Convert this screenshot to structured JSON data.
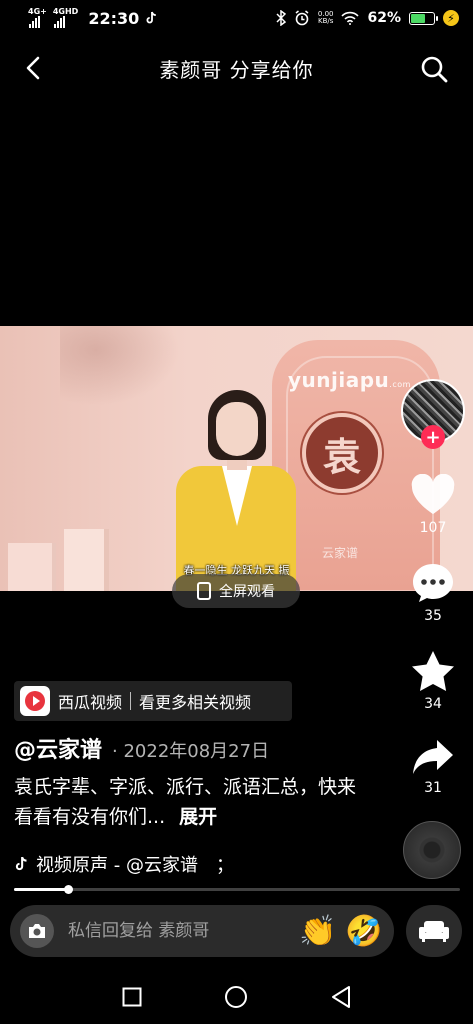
{
  "status_bar": {
    "network_1": "4G+",
    "network_2": "4GHD",
    "time": "22:30",
    "net_speed_value": "0.00",
    "net_speed_unit": "KB/s",
    "battery_percent": "62%",
    "battery_level": 0.62,
    "battery_color": "#4cd964"
  },
  "header": {
    "title": "素颜哥 分享给你",
    "back_icon": "chevron-left-icon",
    "search_icon": "search-icon"
  },
  "video": {
    "watermark_site": "yunjiapu",
    "watermark_tld": ".com",
    "seal_char": "袁",
    "card_brand": "云家谱",
    "subtitle": "春一隐生 龙跃九天 振",
    "fullscreen_label": "全屏观看"
  },
  "side": {
    "like_count": "107",
    "comment_count": "35",
    "favorite_count": "34",
    "share_count": "31",
    "follow_icon": "plus-icon",
    "accent_color": "#fe2c55"
  },
  "info": {
    "xigua_name": "西瓜视频",
    "xigua_more": "看更多相关视频",
    "author": "@云家谱",
    "date": "· 2022年08月27日",
    "description": "袁氏字辈、字派、派行、派语汇总，快来看看有没有你们...",
    "expand_label": "展开",
    "music": "视频原声 - @云家谱",
    "music_tail": "；",
    "progress": 0.12
  },
  "reply": {
    "placeholder": "私信回复给 素颜哥",
    "emoji_1": "👏",
    "emoji_2": "🤣"
  }
}
